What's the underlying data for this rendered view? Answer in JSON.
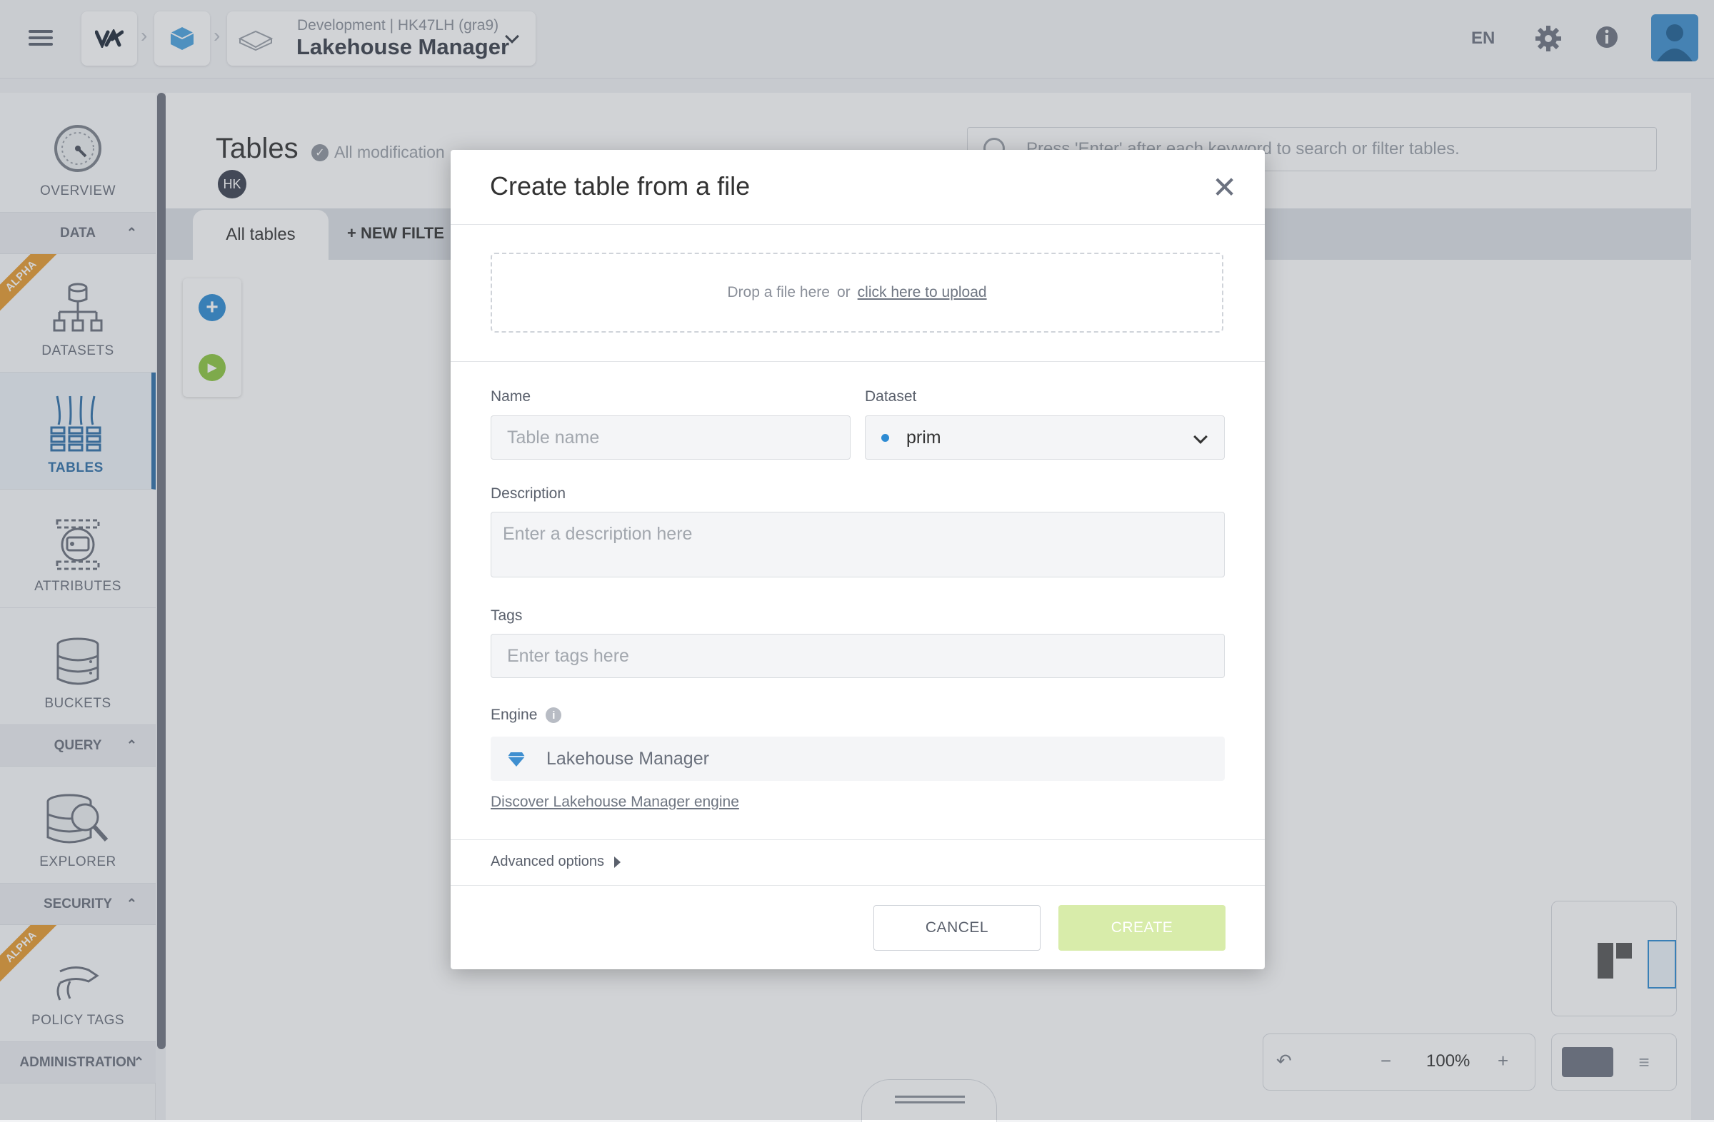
{
  "topbar": {
    "environment": "Development",
    "project_id": "HK47LH (gra9)",
    "project_sep": "|",
    "app_title": "Lakehouse Manager",
    "language": "EN"
  },
  "sidebar": {
    "items": [
      {
        "label": "OVERVIEW"
      },
      {
        "label": "DATASETS",
        "badge": "ALPHA"
      },
      {
        "label": "TABLES"
      },
      {
        "label": "ATTRIBUTES"
      },
      {
        "label": "BUCKETS"
      },
      {
        "label": "EXPLORER"
      },
      {
        "label": "POLICY TAGS",
        "badge": "ALPHA"
      }
    ],
    "sections": {
      "data": "DATA",
      "query": "QUERY",
      "security": "SECURITY",
      "administration": "ADMINISTRATION"
    }
  },
  "page": {
    "title": "Tables",
    "saved_status": "All modification",
    "user_initials": "HK",
    "search_placeholder": "Press 'Enter' after each keyword to search or filter tables.",
    "tab_all": "All tables",
    "new_filter": "NEW FILTE",
    "zoom": "100%"
  },
  "modal": {
    "title": "Create table from a file",
    "drop_text": "Drop a file here",
    "drop_or": "or",
    "upload_link": "click here to upload",
    "name_label": "Name",
    "name_placeholder": "Table name",
    "dataset_label": "Dataset",
    "dataset_value": "prim",
    "description_label": "Description",
    "description_placeholder": "Enter a description here",
    "tags_label": "Tags",
    "tags_placeholder": "Enter tags here",
    "engine_label": "Engine",
    "engine_value": "Lakehouse Manager",
    "discover_link": "Discover Lakehouse Manager engine",
    "advanced_options": "Advanced options",
    "cancel_label": "CANCEL",
    "create_label": "CREATE"
  },
  "colors": {
    "accent_blue": "#2e6fa8",
    "alpha_orange": "#e69a2e",
    "create_disabled": "#d8ecaa",
    "play_green": "#8cc63f"
  }
}
